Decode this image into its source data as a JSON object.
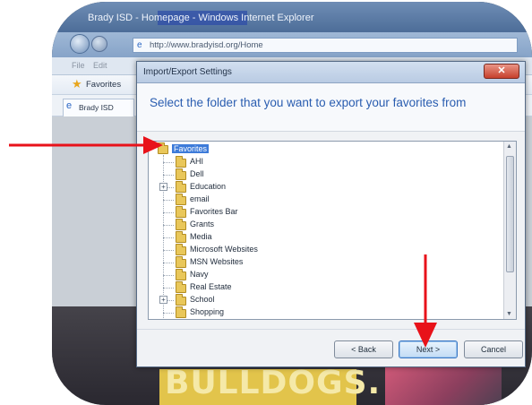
{
  "browser": {
    "title": "Brady ISD - Homepage - Windows Internet Explorer",
    "address": "http://www.bradyisd.org/Home",
    "menu": [
      "File",
      "Edit"
    ],
    "favorites_label": "Favorites",
    "tab_label": "Brady ISD"
  },
  "webpage": {
    "banner_text": "BULLDOGS."
  },
  "dialog": {
    "title": "Import/Export Settings",
    "close_label": "✕",
    "heading": "Select the folder that you want to export your favorites from",
    "tree": {
      "root": "Favorites",
      "items": [
        {
          "label": "AHI",
          "expandable": false
        },
        {
          "label": "Dell",
          "expandable": false
        },
        {
          "label": "Education",
          "expandable": true
        },
        {
          "label": "email",
          "expandable": false
        },
        {
          "label": "Favorites Bar",
          "expandable": false
        },
        {
          "label": "Grants",
          "expandable": false
        },
        {
          "label": "Media",
          "expandable": false
        },
        {
          "label": "Microsoft Websites",
          "expandable": false
        },
        {
          "label": "MSN Websites",
          "expandable": false
        },
        {
          "label": "Navy",
          "expandable": false
        },
        {
          "label": "Real Estate",
          "expandable": false
        },
        {
          "label": "School",
          "expandable": true
        },
        {
          "label": "Shopping",
          "expandable": false
        }
      ]
    },
    "buttons": {
      "back": "< Back",
      "next": "Next >",
      "cancel": "Cancel"
    }
  },
  "annotation_color": "#e8121a",
  "icons": {
    "root_folder": "folder-icon",
    "favorites": "star-icon",
    "page": "ie-e-icon",
    "close": "close-icon"
  }
}
